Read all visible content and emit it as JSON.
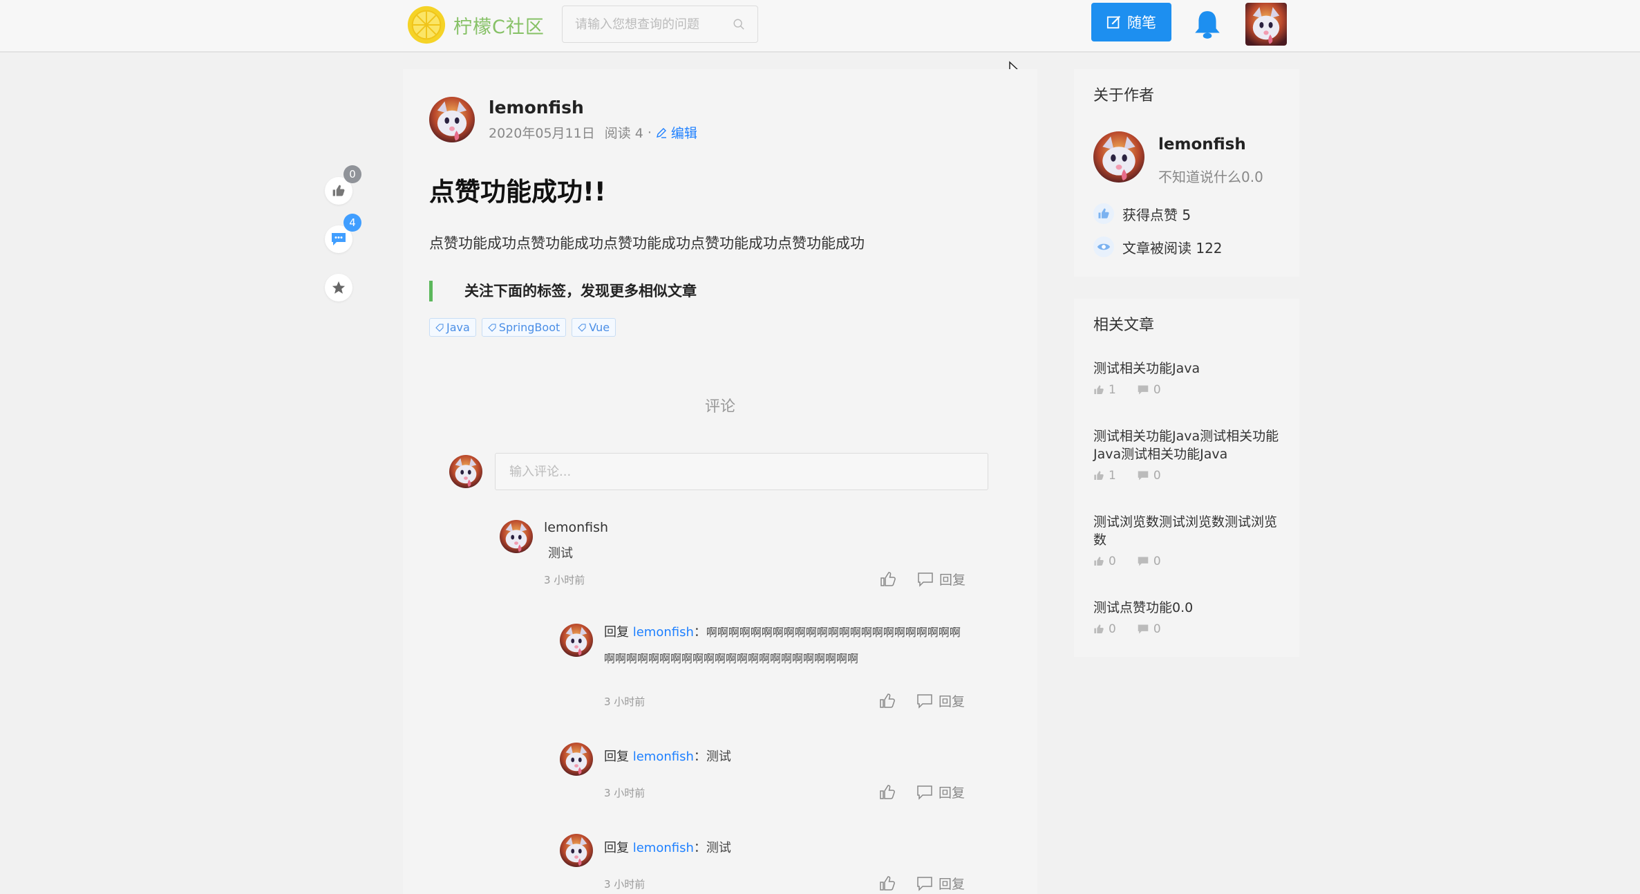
{
  "header": {
    "logo_text": "柠檬C社区",
    "search_placeholder": "请输入您想查询的问题",
    "write_label": "随笔"
  },
  "float_actions": {
    "like_count": "0",
    "comment_count": "4"
  },
  "article": {
    "author": "lemonfish",
    "date": "2020年05月11日",
    "reads": "阅读 4",
    "separator": "·",
    "edit_label": "编辑",
    "title": "点赞功能成功!!",
    "body": "点赞功能成功点赞功能成功点赞功能成功点赞功能成功点赞功能成功",
    "tag_hint": "关注下面的标签，发现更多相似文章",
    "tags": [
      "Java",
      "SpringBoot",
      "Vue"
    ]
  },
  "comments_section": {
    "title": "评论",
    "input_placeholder": "输入评论...",
    "comment": {
      "name": "lemonfish",
      "text": "测试",
      "time": "3 小时前",
      "reply_label": "回复"
    },
    "replies": [
      {
        "prefix": "回复",
        "who": "lemonfish",
        "colon": "：",
        "text": "啊啊啊啊啊啊啊啊啊啊啊啊啊啊啊啊啊啊啊啊啊啊啊啊啊啊啊啊啊啊啊啊啊啊啊啊啊啊啊啊啊啊啊啊啊啊",
        "time": "3 小时前",
        "reply_label": "回复"
      },
      {
        "prefix": "回复",
        "who": "lemonfish",
        "colon": "：",
        "text": "测试",
        "time": "3 小时前",
        "reply_label": "回复"
      },
      {
        "prefix": "回复",
        "who": "lemonfish",
        "colon": "：",
        "text": "测试",
        "time": "3 小时前",
        "reply_label": "回复"
      }
    ]
  },
  "about_author": {
    "title": "关于作者",
    "name": "lemonfish",
    "desc": "不知道说什么0.0",
    "likes_label": "获得点赞 5",
    "reads_label": "文章被阅读 122"
  },
  "related": {
    "title": "相关文章",
    "items": [
      {
        "title": "测试相关功能Java",
        "likes": "1",
        "comments": "0"
      },
      {
        "title": "测试相关功能Java测试相关功能Java测试相关功能Java",
        "likes": "1",
        "comments": "0"
      },
      {
        "title": "测试浏览数测试浏览数测试浏览数",
        "likes": "0",
        "comments": "0"
      },
      {
        "title": "测试点赞功能0.0",
        "likes": "0",
        "comments": "0"
      }
    ]
  },
  "colors": {
    "accent_blue": "#1e80ff",
    "logo_green": "#86c166",
    "badge_gray": "#909399",
    "badge_blue": "#409eff"
  }
}
